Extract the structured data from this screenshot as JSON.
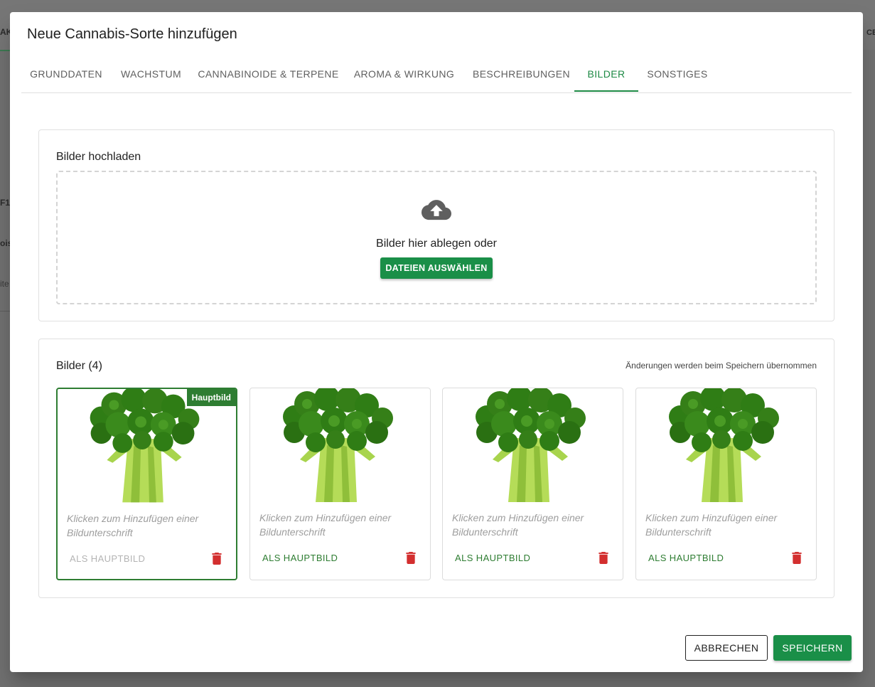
{
  "background": {
    "left_fragments": [
      "AK",
      "F1",
      "ois",
      "ite"
    ],
    "right_fragment": "CE"
  },
  "dialog": {
    "title": "Neue Cannabis-Sorte hinzufügen",
    "tabs": [
      {
        "label": "GRUNDDATEN",
        "active": false
      },
      {
        "label": "WACHSTUM",
        "active": false
      },
      {
        "label": "CANNABINOIDE & TERPENE",
        "active": false
      },
      {
        "label": "AROMA & WIRKUNG",
        "active": false
      },
      {
        "label": "BESCHREIBUNGEN",
        "active": false
      },
      {
        "label": "BILDER",
        "active": true
      },
      {
        "label": "SONSTIGES",
        "active": false
      }
    ]
  },
  "upload": {
    "title": "Bilder hochladen",
    "drop_text": "Bilder hier ablegen oder",
    "select_button": "DATEIEN AUSWÄHLEN",
    "icon": "cloud-upload-icon"
  },
  "gallery": {
    "title": "Bilder (4)",
    "hint": "Änderungen werden beim Speichern übernommen",
    "images": [
      {
        "badge": "Hauptbild",
        "caption": "Klicken zum Hinzufügen einer Bildunterschrift",
        "action": "ALS HAUPTBILD",
        "is_main": true
      },
      {
        "caption": "Klicken zum Hinzufügen einer Bildunterschrift",
        "action": "ALS HAUPTBILD",
        "is_main": false
      },
      {
        "caption": "Klicken zum Hinzufügen einer Bildunterschrift",
        "action": "ALS HAUPTBILD",
        "is_main": false
      },
      {
        "caption": "Klicken zum Hinzufügen einer Bildunterschrift",
        "action": "ALS HAUPTBILD",
        "is_main": false
      }
    ]
  },
  "footer": {
    "cancel": "ABBRECHEN",
    "save": "SPEICHERN"
  },
  "colors": {
    "accent": "#1a8f48",
    "main_border": "#2e7d32",
    "delete": "#d32f2f"
  }
}
